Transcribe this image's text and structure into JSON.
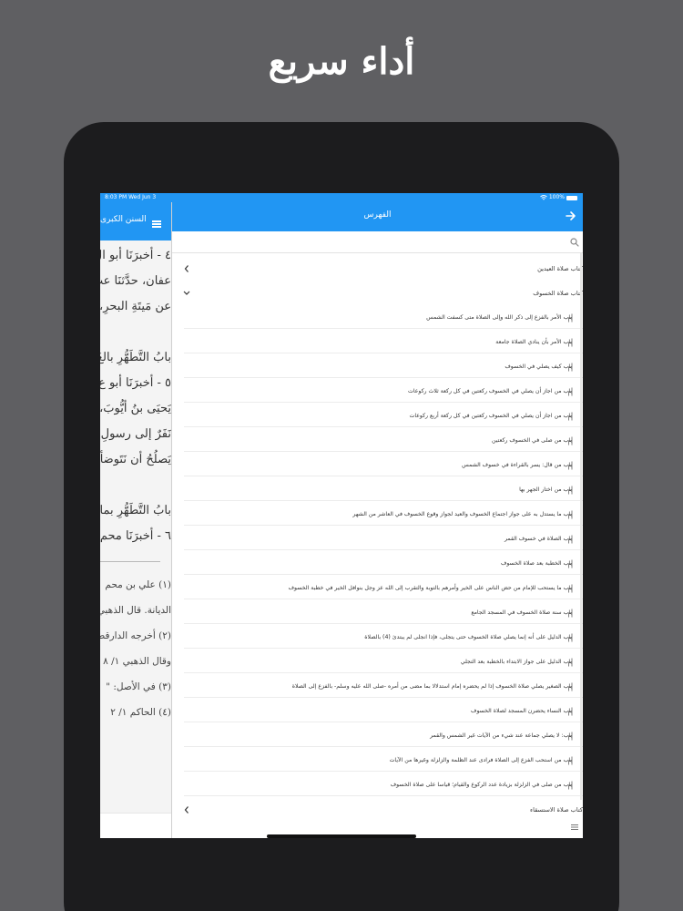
{
  "promo": {
    "headline": "أداء سريع"
  },
  "status_bar": {
    "time": "8:03 PM  Wed Jun 3",
    "battery": "100%"
  },
  "left_pane": {
    "title": "السنن الكبرى",
    "main_lines": [
      "٤ - أخبرَنَا أبو ال",
      "عفان، حدَّثنَا عب",
      "عن مَيتَةِ البحرِ،",
      "بابُ التَّطَهُّرِ بالغَ",
      "٥ - أخبرَنَا أبو ع",
      "يَحيَى بنُ أيُّوبَ،",
      "نَفَرٌ إلى رسولِ الـ",
      "يَصلُحُ أن نَتَوضأ",
      "بابُ التَّطَهُّرِ بماء",
      "٦ - أخبرَنَا محم"
    ],
    "notes": [
      "(١) علي بن محم",
      "الديانة. قال الذهبي",
      "(٢) أخرجه الدارقط",
      "وقال الذهبي ١/ ٨",
      "(٣) في الأصل: \"",
      "(٤) الحاكم ١/ ٢"
    ]
  },
  "index": {
    "title": "الفهرس",
    "search_placeholder": "",
    "rows": [
      {
        "type": "section",
        "label": "كتاب صلاة العيدين",
        "expanded": false
      },
      {
        "type": "section",
        "label": "كتاب صلاة الخسوف",
        "expanded": true
      },
      {
        "type": "chapter",
        "label": "باب الأمر بالفزع إلى ذكر الله وإلى الصلاة متى كسفت الشمس"
      },
      {
        "type": "chapter",
        "label": "باب الأمر بأن ينادي الصلاة جامعة"
      },
      {
        "type": "chapter",
        "label": "باب كيف يصلي في الخسوف"
      },
      {
        "type": "chapter",
        "label": "باب من اجاز أن يصلي في الخسوف ركعتين في كل ركعة ثلاث ركوعات"
      },
      {
        "type": "chapter",
        "label": "باب من اجاز أن يصلي في الخسوف ركعتين في كل ركعة أربع ركوعات"
      },
      {
        "type": "chapter",
        "label": "باب من صلى في الخسوف ركعتين"
      },
      {
        "type": "chapter",
        "label": "باب من قال: يسر بالقراءة في خسوف الشمس"
      },
      {
        "type": "chapter",
        "label": "باب من اختار الجهر بها"
      },
      {
        "type": "chapter",
        "label": "باب ما يستدل به على جواز اجتماع الخسوف والعيد لجواز وقوع الخسوف في العاشر من الشهر"
      },
      {
        "type": "chapter",
        "label": "باب الصلاة في خسوف القمر"
      },
      {
        "type": "chapter",
        "label": "باب الخطبة بعد صلاة الخسوف"
      },
      {
        "type": "chapter",
        "label": "باب ما يستحب للإمام من حض الناس على الخير وأمرهم بالتوبة والتقرب إلى الله عز وجل بنوافل الخير في خطبة الخسوف"
      },
      {
        "type": "chapter",
        "label": "باب سنة صلاة الخسوف في المسجد الجامع"
      },
      {
        "type": "chapter",
        "label": "باب الدليل على أنه إنما يصلي صلاة الخسوف حتى يتجلى، فإذا انجلى لم يبتدئ (4) بالصلاة"
      },
      {
        "type": "chapter",
        "label": "باب الدليل على جواز الابتداء بالخطبة بعد التجلي"
      },
      {
        "type": "chapter",
        "label": "باب الصغير يصلي صلاة الخسوف إذا لم يحضره إمام استدلالا بما مضى من أمره -صلى الله عليه وسلم- بالفزع إلى الصلاة"
      },
      {
        "type": "chapter",
        "label": "باب النساء يحضرن المسجد لصلاة الخسوف"
      },
      {
        "type": "chapter",
        "label": "باب: لا يصلي جماعة عند شيء من الآيات غير الشمس والقمر"
      },
      {
        "type": "chapter",
        "label": "باب من استحب الفزع إلى الصلاة فرادى عند الظلمة والزلزلة وغيرها من الآيات"
      },
      {
        "type": "chapter",
        "label": "باب من صلى في الزلزلة بزيادة عدد الركوع والقيام؛ قياسا على صلاة الخسوف"
      },
      {
        "type": "section",
        "label": "كتاب صلاة الاستسقاء",
        "expanded": false
      }
    ]
  },
  "colors": {
    "accent": "#2196f3",
    "backdrop": "#5f5f62",
    "device": "#1c1c1e"
  },
  "icons": [
    "hamburger-icon",
    "arrow-right-icon",
    "search-icon",
    "chevron-icon",
    "bookmark-icon",
    "lines-icon",
    "wifi-icon",
    "battery-icon"
  ]
}
